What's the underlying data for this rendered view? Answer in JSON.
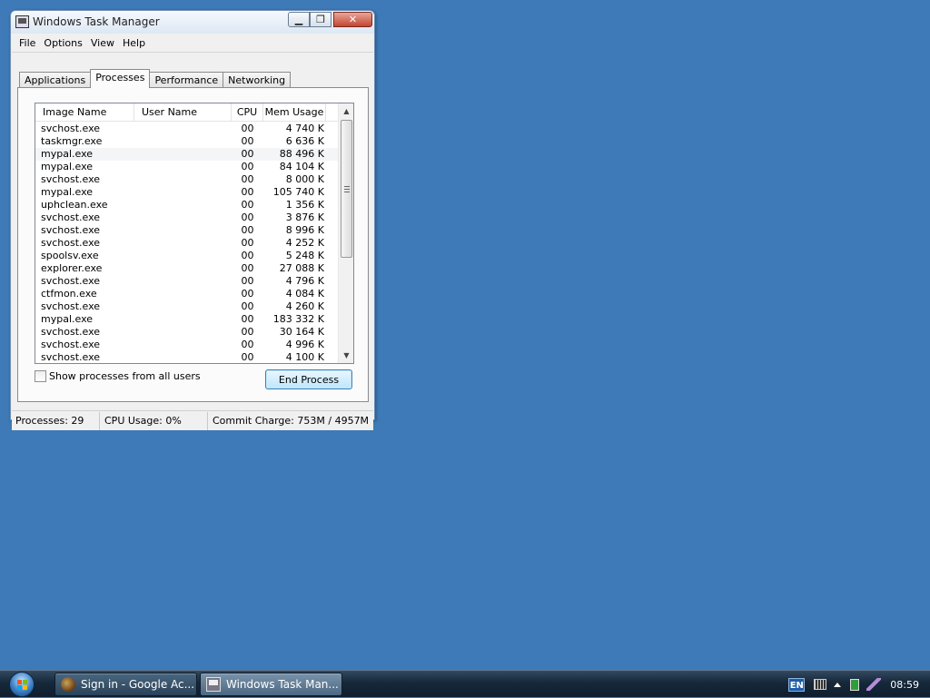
{
  "window": {
    "title": "Windows Task Manager",
    "controls": {
      "minimize": "▁",
      "maximize": "❐",
      "close": "✕"
    }
  },
  "menu": [
    "File",
    "Options",
    "View",
    "Help"
  ],
  "tabs": [
    {
      "label": "Applications",
      "active": false
    },
    {
      "label": "Processes",
      "active": true
    },
    {
      "label": "Performance",
      "active": false
    },
    {
      "label": "Networking",
      "active": false
    }
  ],
  "processes": {
    "columns": [
      "Image Name",
      "User Name",
      "CPU",
      "Mem Usage"
    ],
    "rows": [
      {
        "image": "svchost.exe",
        "user": "",
        "cpu": "00",
        "mem": "4 740 K"
      },
      {
        "image": "taskmgr.exe",
        "user": "",
        "cpu": "00",
        "mem": "6 636 K"
      },
      {
        "image": "mypal.exe",
        "user": "",
        "cpu": "00",
        "mem": "88 496 K"
      },
      {
        "image": "mypal.exe",
        "user": "",
        "cpu": "00",
        "mem": "84 104 K"
      },
      {
        "image": "svchost.exe",
        "user": "",
        "cpu": "00",
        "mem": "8 000 K"
      },
      {
        "image": "mypal.exe",
        "user": "",
        "cpu": "00",
        "mem": "105 740 K"
      },
      {
        "image": "uphclean.exe",
        "user": "",
        "cpu": "00",
        "mem": "1 356 K"
      },
      {
        "image": "svchost.exe",
        "user": "",
        "cpu": "00",
        "mem": "3 876 K"
      },
      {
        "image": "svchost.exe",
        "user": "",
        "cpu": "00",
        "mem": "8 996 K"
      },
      {
        "image": "svchost.exe",
        "user": "",
        "cpu": "00",
        "mem": "4 252 K"
      },
      {
        "image": "spoolsv.exe",
        "user": "",
        "cpu": "00",
        "mem": "5 248 K"
      },
      {
        "image": "explorer.exe",
        "user": "",
        "cpu": "00",
        "mem": "27 088 K"
      },
      {
        "image": "svchost.exe",
        "user": "",
        "cpu": "00",
        "mem": "4 796 K"
      },
      {
        "image": "ctfmon.exe",
        "user": "",
        "cpu": "00",
        "mem": "4 084 K"
      },
      {
        "image": "svchost.exe",
        "user": "",
        "cpu": "00",
        "mem": "4 260 K"
      },
      {
        "image": "mypal.exe",
        "user": "",
        "cpu": "00",
        "mem": "183 332 K"
      },
      {
        "image": "svchost.exe",
        "user": "",
        "cpu": "00",
        "mem": "30 164 K"
      },
      {
        "image": "svchost.exe",
        "user": "",
        "cpu": "00",
        "mem": "4 996 K"
      },
      {
        "image": "svchost.exe",
        "user": "",
        "cpu": "00",
        "mem": "4 100 K"
      }
    ],
    "highlighted_row": 2,
    "show_all_users_label": "Show processes from all users",
    "show_all_users_checked": false,
    "end_process_label": "End Process"
  },
  "status": {
    "processes": "Processes: 29",
    "cpu": "CPU Usage: 0%",
    "commit": "Commit Charge: 753M / 4957M"
  },
  "taskbar": {
    "buttons": [
      {
        "label": "Sign in - Google Ac...",
        "icon": "browser-icon"
      },
      {
        "label": "Windows Task Man...",
        "icon": "task-manager-icon"
      }
    ],
    "language": "EN",
    "clock": "08:59"
  },
  "colors": {
    "desktop": "#3d7ab7",
    "taskbar": "#16283a",
    "close_button": "#c4452f"
  }
}
